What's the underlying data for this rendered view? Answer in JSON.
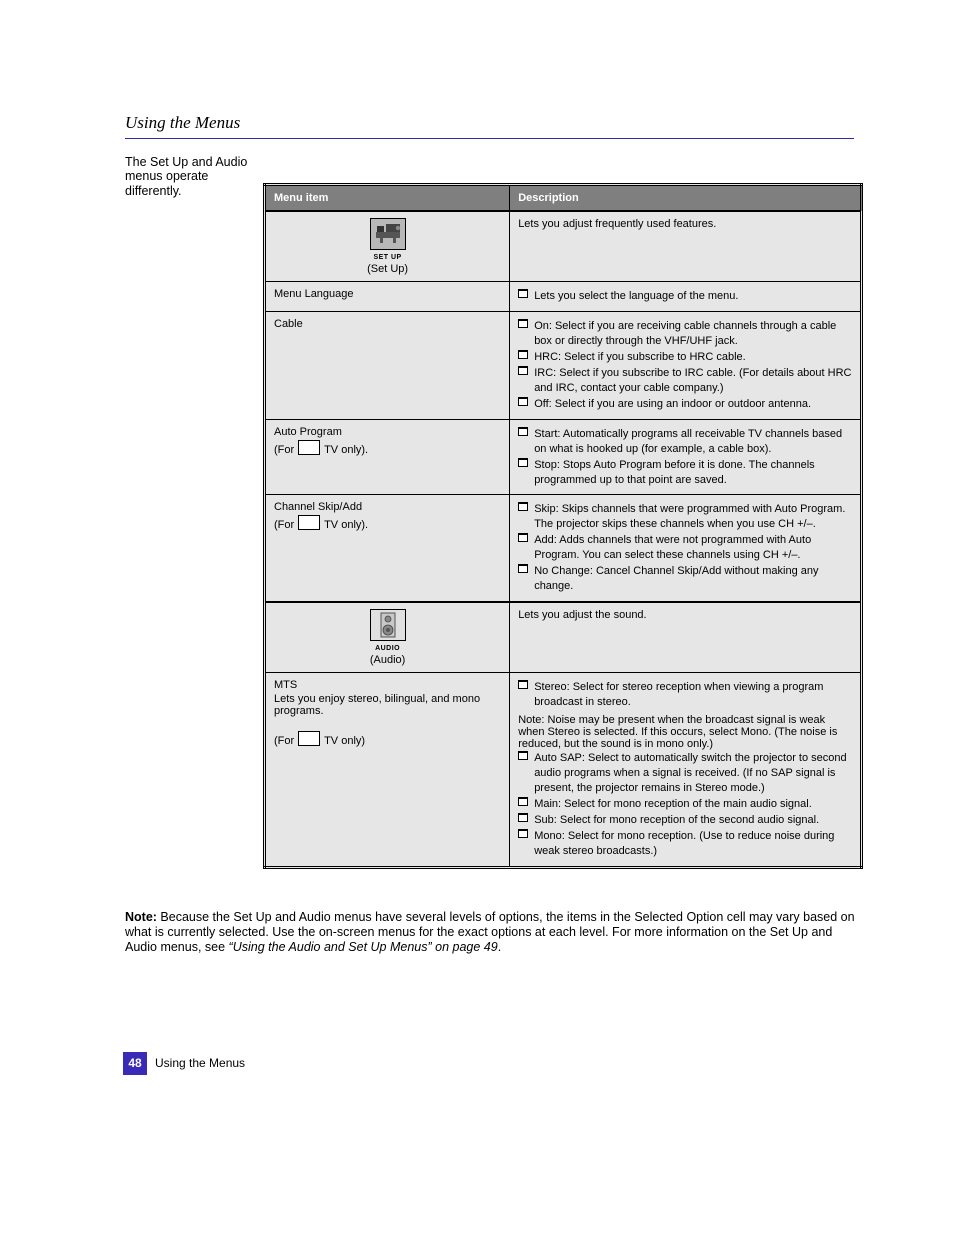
{
  "header": {
    "section_title": "Using the Menus"
  },
  "lead": "The Set Up and Audio menus operate differently.",
  "table": {
    "head": {
      "menu": "Menu item",
      "desc": "Description"
    },
    "setup_icon_caption": "SET UP",
    "audio_icon_caption": "AUDIO",
    "rows": [
      {
        "menu_html": "(Set Up)",
        "desc_html": "Lets you adjust frequently used features."
      },
      {
        "menu_html": "Menu Language",
        "opts": [
          "Lets you select the language of the menu."
        ]
      },
      {
        "menu_html": "Cable",
        "opts": [
          "On: Select if you are receiving cable channels through a cable box or directly through the VHF/UHF jack.",
          "HRC: Select if you subscribe to HRC cable.",
          "IRC: Select if you subscribe to IRC cable. (For details about HRC and IRC, contact your cable company.)",
          "Off: Select if you are using an indoor or outdoor antenna."
        ]
      },
      {
        "menu_html": "Auto Program<br><span class=\"menu-sub\">(For <span class=\"tv-box\"></span> TV only).</span>",
        "opts": [
          "Start: Automatically programs all receivable TV channels based on what is hooked up (for example, a cable box).",
          "Stop: Stops Auto Program before it is done. The channels programmed up to that point are saved."
        ]
      },
      {
        "menu_html": "Channel Skip/Add<br><span class=\"menu-sub\">(For <span class=\"tv-box\"></span> TV only).</span>",
        "opts": [
          "Skip: Skips channels that were programmed with Auto Program. The projector skips these channels when you use CH +/–.",
          "Add: Adds channels that were not programmed with Auto Program. You can select these channels using CH +/–.",
          "No Change: Cancel Channel Skip/Add without making any change."
        ]
      },
      {
        "menu_html": "(Audio)",
        "desc_html": "Lets you adjust the sound."
      },
      {
        "menu_html": "MTS<br><span class=\"menu-sub\">Lets you enjoy stereo, bilingual, and mono programs.</span><br><span class=\"menu-sub\">(For <span class=\"tv-box\"></span> TV only)</span>",
        "opts": [
          "Stereo: Select for stereo reception when viewing a program broadcast in stereo.",
          "Note: Noise may be present when the broadcast signal is weak when Stereo is selected. If this occurs, select Mono. (The noise is reduced, but the sound is in mono only.)",
          "Auto SAP: Select to automatically switch the projector to second audio programs when a signal is received. (If no SAP signal is present, the projector remains in Stereo mode.)",
          "Main: Select for mono reception of the main audio signal.",
          "Sub: Select for mono reception of the second audio signal.",
          "Mono: Select for mono reception. (Use to reduce noise during weak stereo broadcasts.)"
        ],
        "note_index": 1
      }
    ]
  },
  "bottom": {
    "note_label": "Note:",
    "note_body": " Because the Set Up and Audio menus have several levels of options, the items in the Selected Option cell may vary based on what is currently selected. Use the on-screen menus for the exact options at each level. For more information on the Set Up and Audio menus, see ",
    "xref": "“Using the Audio and Set Up Menus” on page 49",
    "note_tail": "."
  },
  "footer": {
    "page_number": "48",
    "text": "Using the Menus"
  }
}
